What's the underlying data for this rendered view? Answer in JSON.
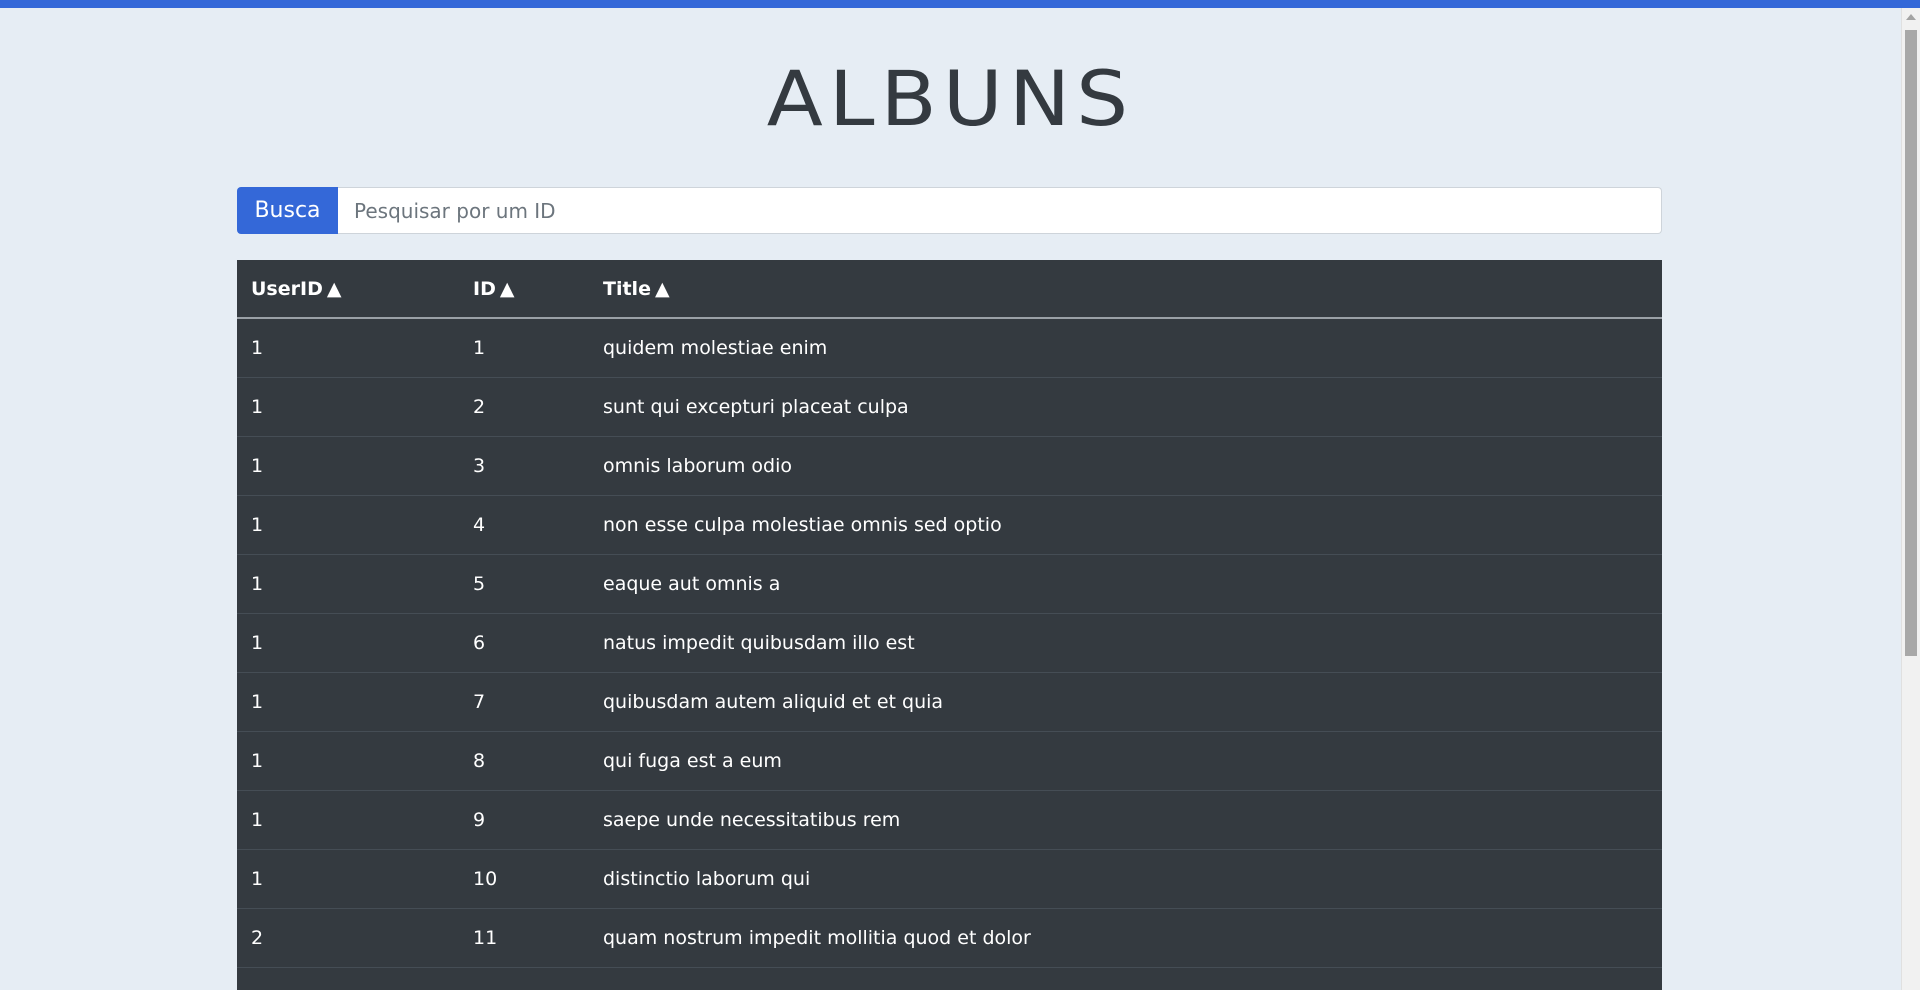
{
  "page": {
    "title": "ALBUNS"
  },
  "search": {
    "label": "Busca",
    "placeholder": "Pesquisar por um ID",
    "value": ""
  },
  "table": {
    "columns": [
      {
        "label": "UserID",
        "sort": "▲"
      },
      {
        "label": "ID",
        "sort": "▲"
      },
      {
        "label": "Title",
        "sort": "▲"
      }
    ],
    "rows": [
      {
        "userId": "1",
        "id": "1",
        "title": "quidem molestiae enim"
      },
      {
        "userId": "1",
        "id": "2",
        "title": "sunt qui excepturi placeat culpa"
      },
      {
        "userId": "1",
        "id": "3",
        "title": "omnis laborum odio"
      },
      {
        "userId": "1",
        "id": "4",
        "title": "non esse culpa molestiae omnis sed optio"
      },
      {
        "userId": "1",
        "id": "5",
        "title": "eaque aut omnis a"
      },
      {
        "userId": "1",
        "id": "6",
        "title": "natus impedit quibusdam illo est"
      },
      {
        "userId": "1",
        "id": "7",
        "title": "quibusdam autem aliquid et et quia"
      },
      {
        "userId": "1",
        "id": "8",
        "title": "qui fuga est a eum"
      },
      {
        "userId": "1",
        "id": "9",
        "title": "saepe unde necessitatibus rem"
      },
      {
        "userId": "1",
        "id": "10",
        "title": "distinctio laborum qui"
      },
      {
        "userId": "2",
        "id": "11",
        "title": "quam nostrum impedit mollitia quod et dolor"
      }
    ]
  },
  "colors": {
    "accent": "#3468d8",
    "background": "#e6edf4",
    "table_bg": "#343a40",
    "table_text": "#ffffff"
  }
}
